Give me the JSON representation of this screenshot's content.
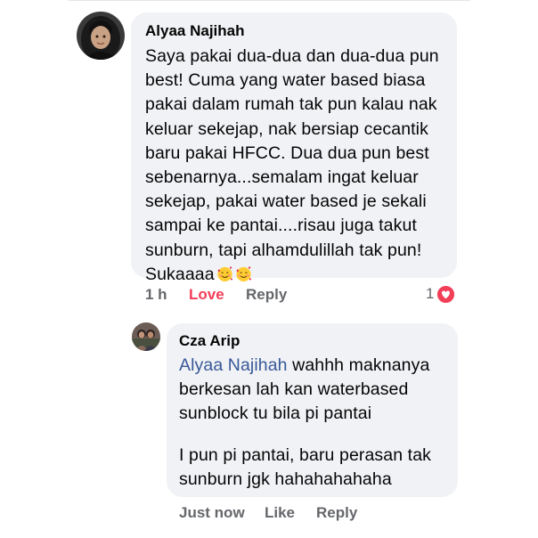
{
  "comment": {
    "author": "Alyaa Najihah",
    "lines": [
      "Saya pakai dua-dua dan dua-dua pun",
      "best! Cuma yang water based biasa",
      "pakai dalam rumah tak pun kalau nak",
      "keluar sekejap, nak bersiap cecantik",
      "baru pakai HFCC. Dua dua pun best",
      "sebenarnya...semalam ingat keluar",
      "sekejap, pakai water based je sekali",
      "sampai ke pantai....risau juga takut",
      "sunburn, tapi alhamdulillah tak pun!",
      "Sukaaaa"
    ],
    "emojis": [
      "smiling-face-with-hearts-icon",
      "smiling-face-with-hearts-icon"
    ],
    "time": "1 h",
    "reaction_label": "Love",
    "reply_label": "Reply",
    "reaction_count": "1",
    "reaction_icon": "love-reaction-icon"
  },
  "reply": {
    "author": "Cza Arip",
    "mention": "Alyaa Najihah",
    "first_line_rest": "wahhh maknanya",
    "lines": [
      "berkesan lah kan waterbased",
      "sunblock tu bila pi pantai"
    ],
    "second_paragraph": [
      "I pun pi pantai, baru perasan tak",
      "sunburn jgk hahahahahaha"
    ],
    "time": "Just now",
    "like_label": "Like",
    "reply_label": "Reply"
  },
  "colors": {
    "bubble": "#f0f2f5",
    "text": "#050505",
    "meta": "#65676b",
    "love": "#f33e58",
    "mention": "#385898"
  }
}
